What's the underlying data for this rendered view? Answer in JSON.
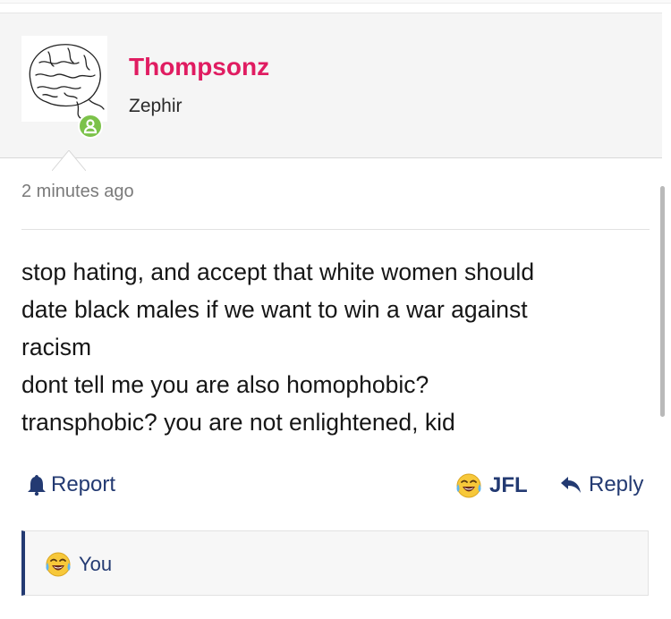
{
  "post": {
    "username": "Thompsonz",
    "rank": "Zephir",
    "time_ago": "2 minutes ago",
    "body_lines": [
      "stop hating, and accept that white women should",
      "date black males if we want to win a war against",
      "racism",
      "dont tell me you are also homophobic?",
      "transphobic? you are not enlightened, kid"
    ]
  },
  "actions": {
    "report_label": "Report",
    "reaction_label": "JFL",
    "reply_label": "Reply"
  },
  "reactions": {
    "you_label": "You"
  },
  "icons": {
    "avatar": "sketch-brain-avatar",
    "online": "user-online-icon",
    "report": "bell-icon",
    "reaction": "tears-of-joy-emoji-icon",
    "reply": "reply-arrow-icon"
  },
  "colors": {
    "username": "#e01c61",
    "action": "#233a72",
    "online": "#7cc24a"
  }
}
